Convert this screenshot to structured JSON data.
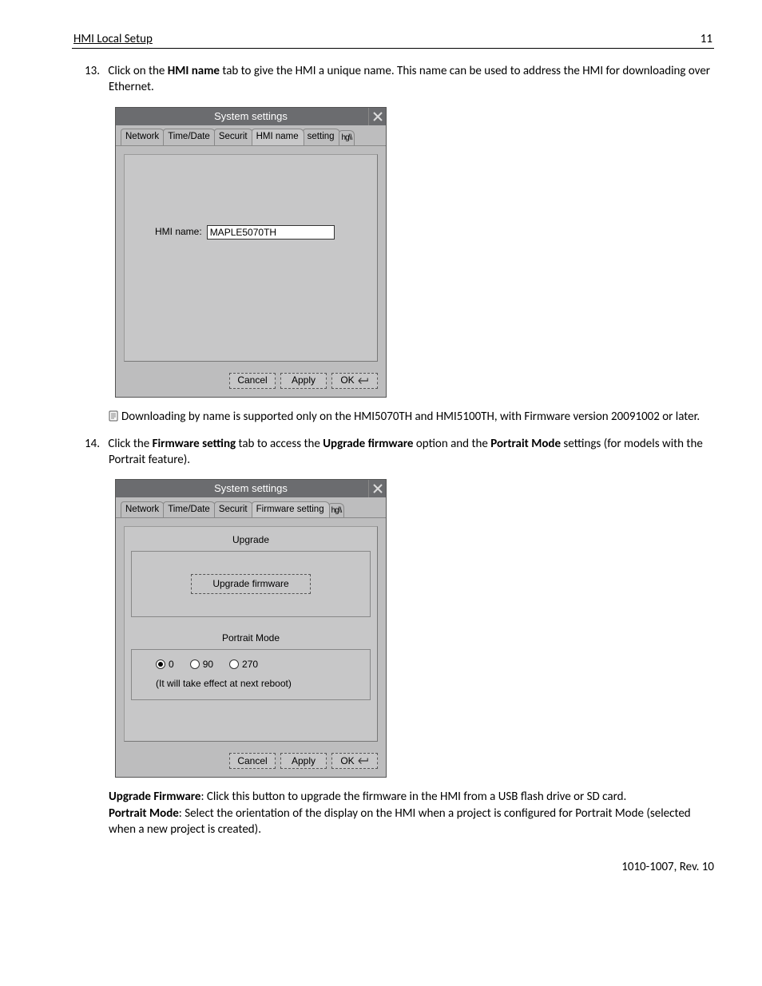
{
  "header": {
    "left": "HMI Local Setup",
    "right": "11"
  },
  "steps": {
    "s13_num": "13.",
    "s13_pre": "Click on the ",
    "s13_bold": "HMI name",
    "s13_post": " tab to give the HMI a unique name. This name can be used to address the HMI for downloading over Ethernet.",
    "s14_num": "14.",
    "s14_pre": "Click the ",
    "s14_b1": "Firmware setting",
    "s14_mid1": " tab to access the ",
    "s14_b2": "Upgrade firmware",
    "s14_mid2": " option and the ",
    "s14_b3": "Portrait Mode",
    "s14_post": " settings (for models with the Portrait feature)."
  },
  "dialog1": {
    "title": "System settings",
    "tabs": {
      "t1": "Network",
      "t2": "Time/Date",
      "t3": "Securit",
      "t4": "HMI name",
      "t5": "setting",
      "scroll": "hg\\\\"
    },
    "hmi_label": "HMI name:",
    "hmi_value": "MAPLE5070TH",
    "cancel": "Cancel",
    "apply": "Apply",
    "ok": "OK"
  },
  "note": "Downloading by name is supported only on the HMI5070TH and HMI5100TH, with Firmware version 20091002 or later.",
  "dialog2": {
    "title": "System settings",
    "tabs": {
      "t1": "Network",
      "t2": "Time/Date",
      "t3": "Securit",
      "t4": "Firmware setting",
      "scroll": "hg\\\\"
    },
    "upgrade_section": "Upgrade",
    "upgrade_btn": "Upgrade firmware",
    "portrait_section": "Portrait Mode",
    "r0": "0",
    "r90": "90",
    "r270": "270",
    "reboot_note": "(It will take effect at next reboot)",
    "cancel": "Cancel",
    "apply": "Apply",
    "ok": "OK"
  },
  "desc": {
    "b1": "Upgrade Firmware",
    "t1": ": Click this button to upgrade the firmware in the HMI from a USB flash drive or SD card.",
    "b2": "Portrait Mode",
    "t2": ": Select the orientation of the display on the HMI when a project is configured for Portrait Mode (selected when a new project is created)."
  },
  "footer": "1010-1007, Rev. 10"
}
